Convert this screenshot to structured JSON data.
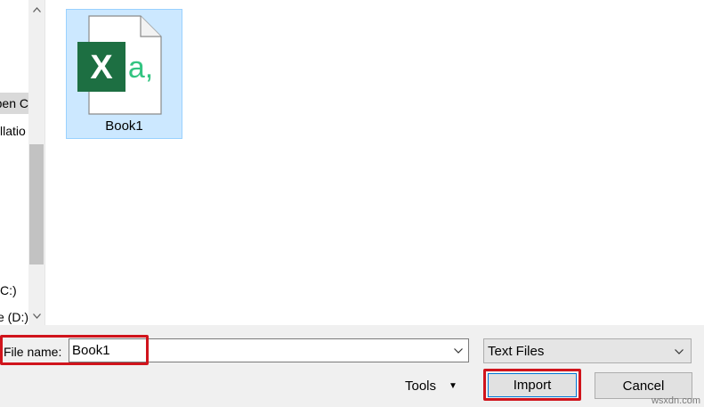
{
  "nav": {
    "items": [
      {
        "label": "Open C",
        "selected": true
      },
      {
        "label": "llatio",
        "selected": false
      },
      {
        "label": "C:)",
        "selected": false
      },
      {
        "label": "e (D:)",
        "selected": false
      }
    ],
    "scroll_up_icon": "chevron-up-icon",
    "scroll_down_icon": "chevron-down-icon"
  },
  "files": [
    {
      "name": "Book1",
      "icon": "excel-text-file-icon",
      "badge_letter": "X",
      "badge_extra": "a,",
      "selected": true
    }
  ],
  "colors": {
    "excel_green": "#1d6f42",
    "excel_light_green": "#33c481",
    "selection_bg": "#cce8ff",
    "highlight_red": "#d0141c"
  },
  "bottom": {
    "filename_label": "File name:",
    "filename_value": "Book1",
    "filetype_value": "Text Files",
    "tools_label": "Tools",
    "import_label": "Import",
    "cancel_label": "Cancel"
  },
  "watermark": "wsxdn.com"
}
